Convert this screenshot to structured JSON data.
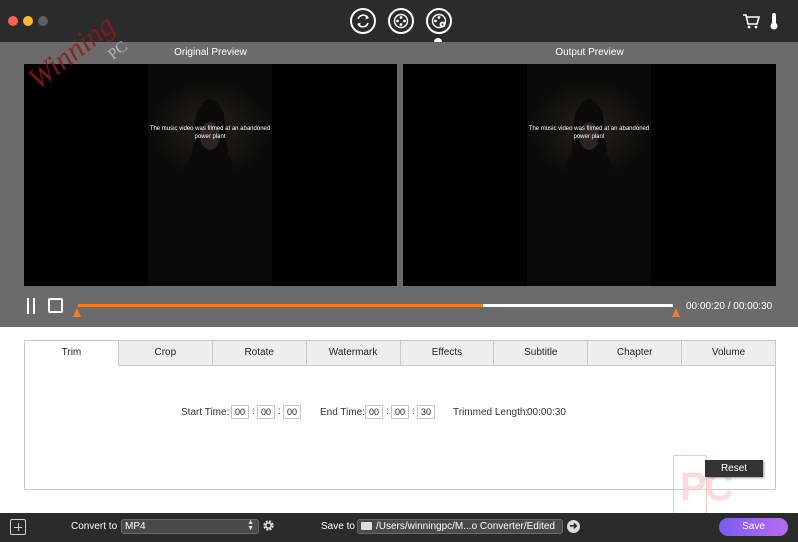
{
  "titlebar": {
    "modes": [
      {
        "name": "convert",
        "icon": "convert-icon"
      },
      {
        "name": "edit",
        "icon": "film-reel-icon"
      },
      {
        "name": "edit-active",
        "icon": "film-reel-settings-icon"
      }
    ],
    "icons": [
      "cart-icon",
      "thermometer-icon"
    ]
  },
  "preview": {
    "original_label": "Original Preview",
    "output_label": "Output Preview",
    "caption": "The music video was filmed at an abandoned power plant"
  },
  "watermark": {
    "text": "Winning",
    "pc": "PC"
  },
  "playback": {
    "time": "00:00:20 / 00:00:30",
    "progress": 0.68,
    "accent": "#f07e2a"
  },
  "tabs": [
    "Trim",
    "Crop",
    "Rotate",
    "Watermark",
    "Effects",
    "Subtitle",
    "Chapter",
    "Volume"
  ],
  "active_tab": "Trim",
  "trim": {
    "start_label": "Start Time:",
    "start": [
      "00",
      "00",
      "00"
    ],
    "end_label": "End Time:",
    "end": [
      "00",
      "00",
      "30"
    ],
    "length_label": "Trimmed Length:",
    "length": "00:00:30",
    "reset_label": "Reset"
  },
  "logo_text": "PC",
  "bottombar": {
    "convert_label": "Convert to",
    "format": "MP4",
    "save_to_label": "Save to",
    "path": "/Users/winningpc/M...o Converter/Edited",
    "save_label": "Save"
  }
}
